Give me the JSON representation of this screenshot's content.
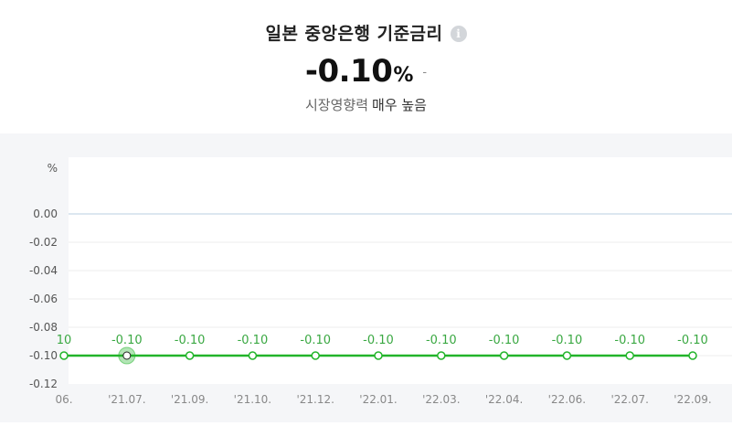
{
  "header": {
    "title": "일본 중앙은행 기준금리",
    "info_icon": "info-icon",
    "value": "-0.10",
    "unit": "%",
    "change": "-",
    "impact_label": "시장영향력",
    "impact_level": "매우 높음"
  },
  "colors": {
    "line": "#22b42a",
    "label": "#3aa842",
    "zero_line": "#b9cfe0",
    "grid": "#eeeeee",
    "background": "#f5f6f8"
  },
  "chart_data": {
    "type": "line",
    "yunit": "%",
    "yticks": [
      "0.00",
      "-0.10",
      "-0.12",
      "-0.06",
      "-0.08",
      "-0.04",
      "-0.02"
    ],
    "ytick_values": [
      0,
      -0.1,
      -0.12,
      -0.06,
      -0.08,
      -0.04,
      -0.02
    ],
    "ylim": [
      -0.12,
      0.02
    ],
    "xticks": [
      "06.",
      "'21.07.",
      "'21.09.",
      "'21.10.",
      "'21.12.",
      "'22.01.",
      "'22.03.",
      "'22.04.",
      "'22.06.",
      "'22.07.",
      "'22.09."
    ],
    "values": [
      -0.1,
      -0.1,
      -0.1,
      -0.1,
      -0.1,
      -0.1,
      -0.1,
      -0.1,
      -0.1,
      -0.1,
      -0.1
    ],
    "data_labels": [
      "10",
      "-0.10",
      "-0.10",
      "-0.10",
      "-0.10",
      "-0.10",
      "-0.10",
      "-0.10",
      "-0.10",
      "-0.10",
      "-0.10"
    ],
    "highlighted_index": 1
  }
}
